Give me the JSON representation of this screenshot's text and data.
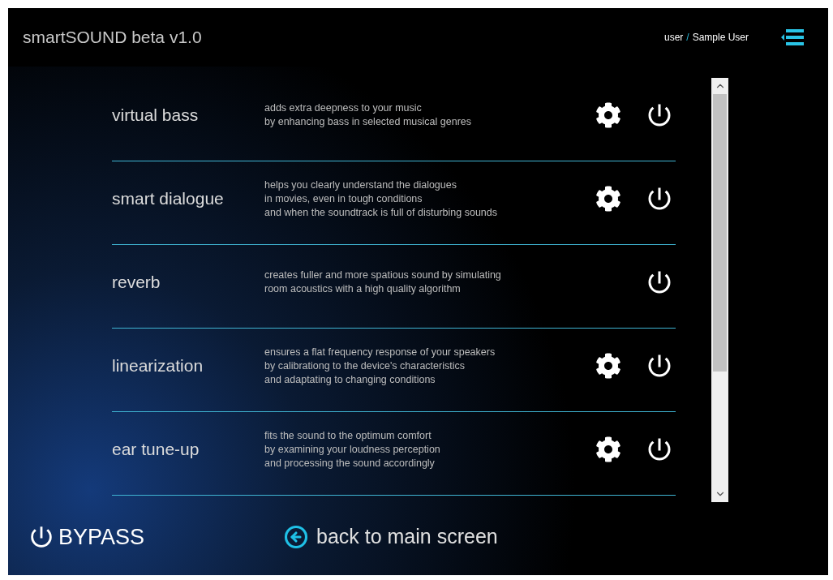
{
  "header": {
    "title": "smartSOUND beta v1.0",
    "user": {
      "role": "user",
      "separator": "/",
      "name": "Sample User"
    }
  },
  "features": [
    {
      "name": "virtual bass",
      "description": [
        "adds extra deepness to your music",
        "by enhancing bass in selected musical genres"
      ],
      "has_settings": true
    },
    {
      "name": "smart dialogue",
      "description": [
        "helps you clearly understand the dialogues",
        "in movies, even in tough conditions",
        "and when the soundtrack is full of disturbing sounds"
      ],
      "has_settings": true
    },
    {
      "name": "reverb",
      "description": [
        "creates fuller and more spatious sound by simulating",
        "room acoustics with a high quality algorithm"
      ],
      "has_settings": false
    },
    {
      "name": "linearization",
      "description": [
        "ensures a flat frequency response of your speakers",
        "by calibrationg to the device's characteristics",
        "and adaptating to changing conditions"
      ],
      "has_settings": true
    },
    {
      "name": "ear tune-up",
      "description": [
        "fits the sound to the optimum comfort",
        "by examining your loudness perception",
        "and processing the sound accordingly"
      ],
      "has_settings": true
    }
  ],
  "footer": {
    "bypass": "BYPASS",
    "back": "back to main screen"
  }
}
